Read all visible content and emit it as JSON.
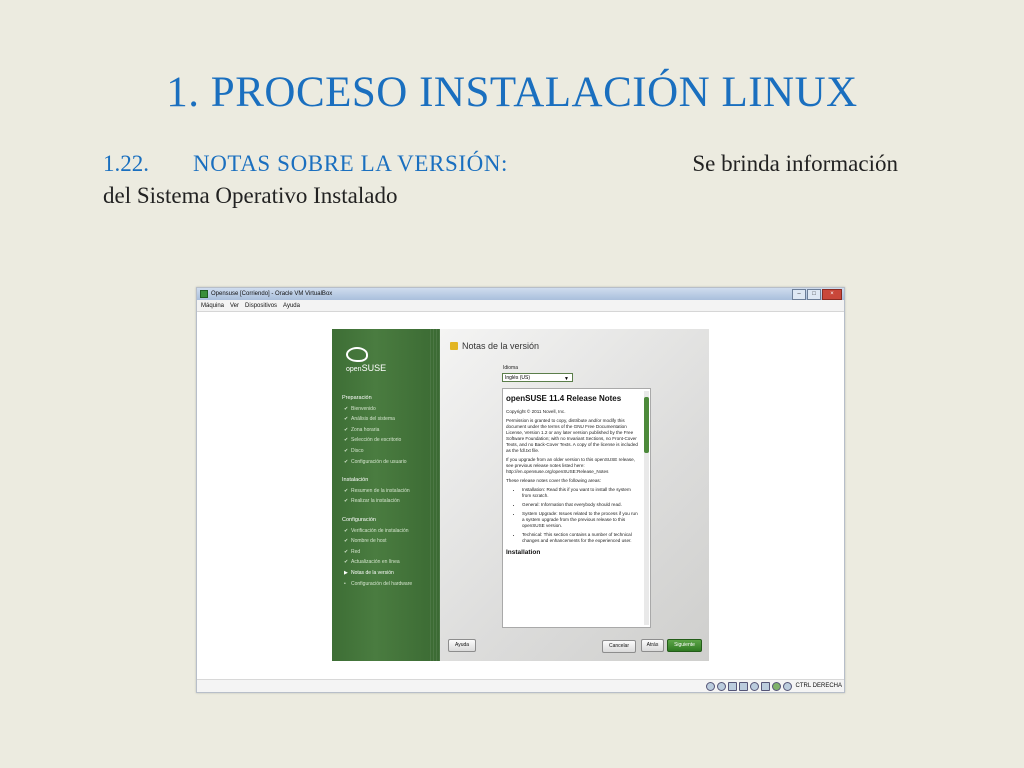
{
  "slide": {
    "title": "1. PROCESO INSTALACIÓN LINUX",
    "section_number": "1.22.",
    "section_heading": "NOTAS SOBRE LA VERSIÓN:",
    "description_1": "Se brinda información",
    "description_2": "del Sistema Operativo Instalado"
  },
  "vbox": {
    "window_title": "Opensuse [Corriendo] - Oracle VM VirtualBox",
    "menu": [
      "Máquina",
      "Ver",
      "Dispositivos",
      "Ayuda"
    ],
    "status_host_key": "CTRL DERECHA"
  },
  "installer": {
    "page_title": "Notas de la versión",
    "brand_light": "open",
    "brand_bold": "SUSE",
    "sections": [
      {
        "label": "Preparación",
        "items": [
          "Bienvenido",
          "Análisis del sistema",
          "Zona horaria",
          "Selección de escritorio",
          "Disco",
          "Configuración de usuario"
        ]
      },
      {
        "label": "Instalación",
        "items": [
          "Resumen de la instalación",
          "Realizar la instalación"
        ]
      },
      {
        "label": "Configuración",
        "items": [
          "Verificación de instalación",
          "Nombre de host",
          "Red",
          "Actualización en línea",
          "Notas de la versión",
          "Configuración del hardware"
        ]
      }
    ],
    "language_label": "Idioma",
    "language_value": "Inglés (US)",
    "notes": {
      "heading": "openSUSE 11.4 Release Notes",
      "copyright": "Copyright © 2011 Novell, Inc.",
      "license": "Permission is granted to copy, distribute and/or modify this document under the terms of the GNU Free Documentation License, Version 1.2 or any later version published by the Free Software Foundation; with no Invariant Sections, no Front-Cover Texts, and no Back-Cover Texts. A copy of the license is included as the fdl.txt file.",
      "upgrade": "If you upgrade from an older version to this openSUSE release, see previous release notes listed here: http://en.opensuse.org/openSUSE:Release_Notes",
      "cover_intro": "These release notes cover the following areas:",
      "bullets": [
        "Installation: Read this if you want to install the system from scratch.",
        "General: Information that everybody should read.",
        "System Upgrade: Issues related to the process if you run a system upgrade from the previous release to this openSUSE version.",
        "Technical: This section contains a number of technical changes and enhancements for the experienced user."
      ],
      "subheading": "Installation"
    },
    "buttons": {
      "help": "Ayuda",
      "cancel": "Cancelar",
      "back": "Atrás",
      "next": "Siguiente"
    }
  },
  "colors": {
    "accent_blue": "#1a6fbf",
    "installer_green": "#4a7c40",
    "next_button": "#3f8c2e"
  }
}
